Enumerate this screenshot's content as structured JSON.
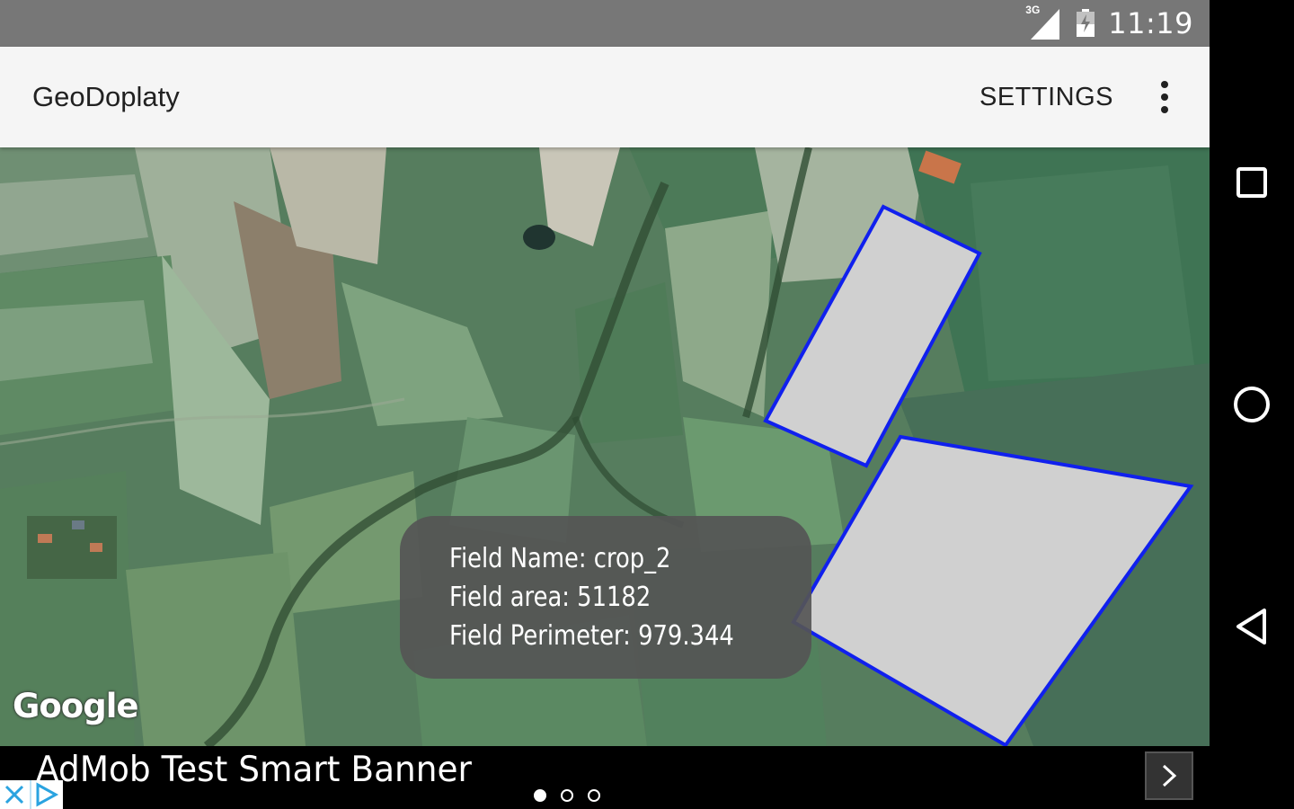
{
  "status_bar": {
    "network": "3G",
    "time": "11:19"
  },
  "app_bar": {
    "title": "GeoDoplaty",
    "settings_label": "SETTINGS"
  },
  "map": {
    "attribution": "Google",
    "info_window": {
      "line1": "Field Name: crop_2",
      "line2": "Field area: 51182",
      "line3": "Field Perimeter: 979.344"
    },
    "polygon_fill": "#d0d0d0",
    "polygon_stroke": "#1020ee"
  },
  "ad": {
    "text": "AdMob Test Smart Banner"
  },
  "nav_bar": {
    "icons": [
      "recents-square-icon",
      "home-circle-icon",
      "back-triangle-icon"
    ]
  },
  "colors": {
    "status_bar": "#777777",
    "app_bar": "#f5f5f5",
    "nav_bar": "#000000"
  }
}
